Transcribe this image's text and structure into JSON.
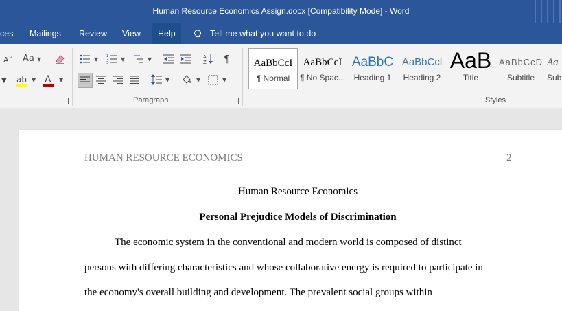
{
  "window": {
    "title": "Human Resource Economics Assign.docx [Compatibility Mode]  -  Word"
  },
  "tabs": [
    {
      "label": "ces",
      "active": false
    },
    {
      "label": "Mailings",
      "active": false
    },
    {
      "label": "Review",
      "active": false
    },
    {
      "label": "View",
      "active": false
    },
    {
      "label": "Help",
      "active": true
    }
  ],
  "tell_me": {
    "placeholder": "Tell me what you want to do"
  },
  "ribbon": {
    "font_group": {
      "change_case": "Aa",
      "font_color_letter": "A",
      "highlight_letters": "ab"
    },
    "paragraph": {
      "label": "Paragraph"
    },
    "styles": {
      "label": "Styles",
      "items": [
        {
          "sample": "AaBbCcI",
          "name": "¶ Normal",
          "selected": true
        },
        {
          "sample": "AaBbCcI",
          "name": "¶ No Spac..."
        },
        {
          "sample": "AaBbC",
          "name": "Heading 1"
        },
        {
          "sample": "AaBbCcl",
          "name": "Heading 2"
        },
        {
          "sample": "AaB",
          "name": "Title"
        },
        {
          "sample": "AaBbCcD",
          "name": "Subtitle"
        },
        {
          "sample": "Aa",
          "name": "Sub"
        }
      ]
    },
    "colors": {
      "font_color": "#c00000",
      "highlight": "#ffff00"
    }
  },
  "document": {
    "header_text": "HUMAN RESOURCE ECONOMICS",
    "page_number": "2",
    "title": "Human Resource Economics",
    "heading": "Personal Prejudice Models of Discrimination",
    "lines": [
      "The economic system in the conventional and modern world is composed of distinct",
      "persons with differing characteristics and whose collaborative energy is required to participate in",
      "the economy's overall building and development. The prevalent social groups within"
    ]
  },
  "colors": {
    "title_bar": "#2b579a",
    "ribbon_bg": "#f3f3f3",
    "workspace": "#e6e6e6"
  }
}
